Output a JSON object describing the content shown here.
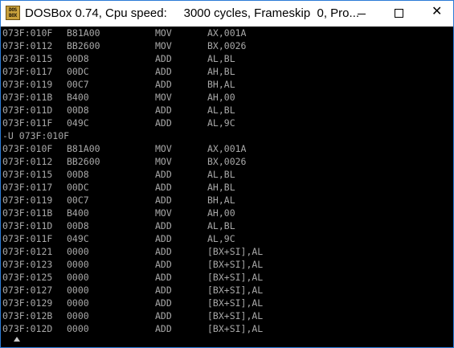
{
  "window": {
    "title": "DOSBox 0.74, Cpu speed:     3000 cycles, Frameskip  0, Pro...",
    "icon_text_top": "DOS",
    "icon_text_bottom": "BOX",
    "close_glyph": "✕"
  },
  "console": {
    "lines": [
      {
        "addr": "073F:010F",
        "hex": "B81A00",
        "mnemonic": "MOV",
        "operands": "AX,001A"
      },
      {
        "addr": "073F:0112",
        "hex": "BB2600",
        "mnemonic": "MOV",
        "operands": "BX,0026"
      },
      {
        "addr": "073F:0115",
        "hex": "00D8",
        "mnemonic": "ADD",
        "operands": "AL,BL"
      },
      {
        "addr": "073F:0117",
        "hex": "00DC",
        "mnemonic": "ADD",
        "operands": "AH,BL"
      },
      {
        "addr": "073F:0119",
        "hex": "00C7",
        "mnemonic": "ADD",
        "operands": "BH,AL"
      },
      {
        "addr": "073F:011B",
        "hex": "B400",
        "mnemonic": "MOV",
        "operands": "AH,00"
      },
      {
        "addr": "073F:011D",
        "hex": "00D8",
        "mnemonic": "ADD",
        "operands": "AL,BL"
      },
      {
        "addr": "073F:011F",
        "hex": "049C",
        "mnemonic": "ADD",
        "operands": "AL,9C"
      },
      {
        "command": "-U 073F:010F"
      },
      {
        "addr": "073F:010F",
        "hex": "B81A00",
        "mnemonic": "MOV",
        "operands": "AX,001A"
      },
      {
        "addr": "073F:0112",
        "hex": "BB2600",
        "mnemonic": "MOV",
        "operands": "BX,0026"
      },
      {
        "addr": "073F:0115",
        "hex": "00D8",
        "mnemonic": "ADD",
        "operands": "AL,BL"
      },
      {
        "addr": "073F:0117",
        "hex": "00DC",
        "mnemonic": "ADD",
        "operands": "AH,BL"
      },
      {
        "addr": "073F:0119",
        "hex": "00C7",
        "mnemonic": "ADD",
        "operands": "BH,AL"
      },
      {
        "addr": "073F:011B",
        "hex": "B400",
        "mnemonic": "MOV",
        "operands": "AH,00"
      },
      {
        "addr": "073F:011D",
        "hex": "00D8",
        "mnemonic": "ADD",
        "operands": "AL,BL"
      },
      {
        "addr": "073F:011F",
        "hex": "049C",
        "mnemonic": "ADD",
        "operands": "AL,9C"
      },
      {
        "addr": "073F:0121",
        "hex": "0000",
        "mnemonic": "ADD",
        "operands": "[BX+SI],AL"
      },
      {
        "addr": "073F:0123",
        "hex": "0000",
        "mnemonic": "ADD",
        "operands": "[BX+SI],AL"
      },
      {
        "addr": "073F:0125",
        "hex": "0000",
        "mnemonic": "ADD",
        "operands": "[BX+SI],AL"
      },
      {
        "addr": "073F:0127",
        "hex": "0000",
        "mnemonic": "ADD",
        "operands": "[BX+SI],AL"
      },
      {
        "addr": "073F:0129",
        "hex": "0000",
        "mnemonic": "ADD",
        "operands": "[BX+SI],AL"
      },
      {
        "addr": "073F:012B",
        "hex": "0000",
        "mnemonic": "ADD",
        "operands": "[BX+SI],AL"
      },
      {
        "addr": "073F:012D",
        "hex": "0000",
        "mnemonic": "ADD",
        "operands": "[BX+SI],AL"
      }
    ]
  },
  "colors": {
    "console_bg": "#000000",
    "console_text": "#a8a8a8",
    "window_border": "#2b7bd6"
  },
  "icons": [
    "dosbox-app-icon",
    "minimize-icon",
    "maximize-icon",
    "close-icon",
    "up-arrow-icon"
  ]
}
